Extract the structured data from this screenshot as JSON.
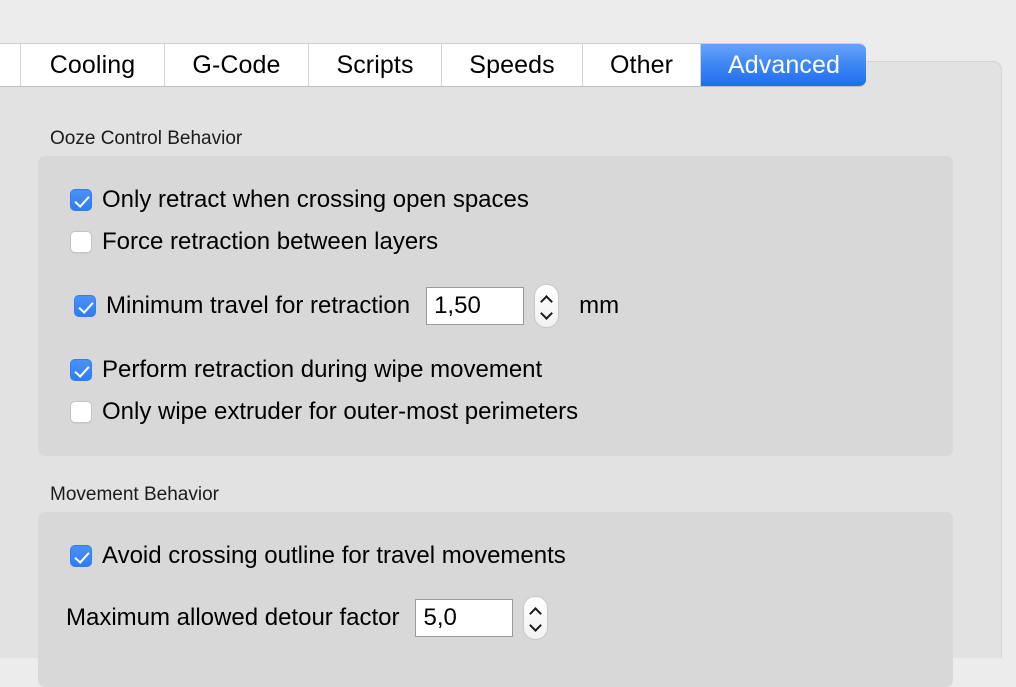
{
  "window": {
    "background_color": "#ececec",
    "panel_color": "#e2e2e2",
    "group_color": "#d8d8d8",
    "accent_color": "#2f7df3"
  },
  "tabs": [
    {
      "label": "Cooling",
      "selected": false
    },
    {
      "label": "G-Code",
      "selected": false
    },
    {
      "label": "Scripts",
      "selected": false
    },
    {
      "label": "Speeds",
      "selected": false
    },
    {
      "label": "Other",
      "selected": false
    },
    {
      "label": "Advanced",
      "selected": true
    }
  ],
  "sections": [
    {
      "title": "Ooze Control Behavior",
      "rows": [
        {
          "type": "checkbox",
          "checked": true,
          "label": "Only retract when crossing open spaces"
        },
        {
          "type": "checkbox",
          "checked": false,
          "label": "Force retraction between layers"
        },
        {
          "type": "checkbox-field",
          "checked": true,
          "label": "Minimum travel for retraction",
          "value": "1,50",
          "unit": "mm"
        },
        {
          "type": "checkbox",
          "checked": true,
          "label": "Perform retraction during wipe movement"
        },
        {
          "type": "checkbox",
          "checked": false,
          "label": "Only wipe extruder for outer-most perimeters"
        }
      ]
    },
    {
      "title": "Movement Behavior",
      "rows": [
        {
          "type": "checkbox",
          "checked": true,
          "label": "Avoid crossing outline for travel movements"
        },
        {
          "type": "label-field",
          "label": "Maximum allowed detour factor",
          "value": "5,0",
          "unit": ""
        }
      ]
    }
  ]
}
